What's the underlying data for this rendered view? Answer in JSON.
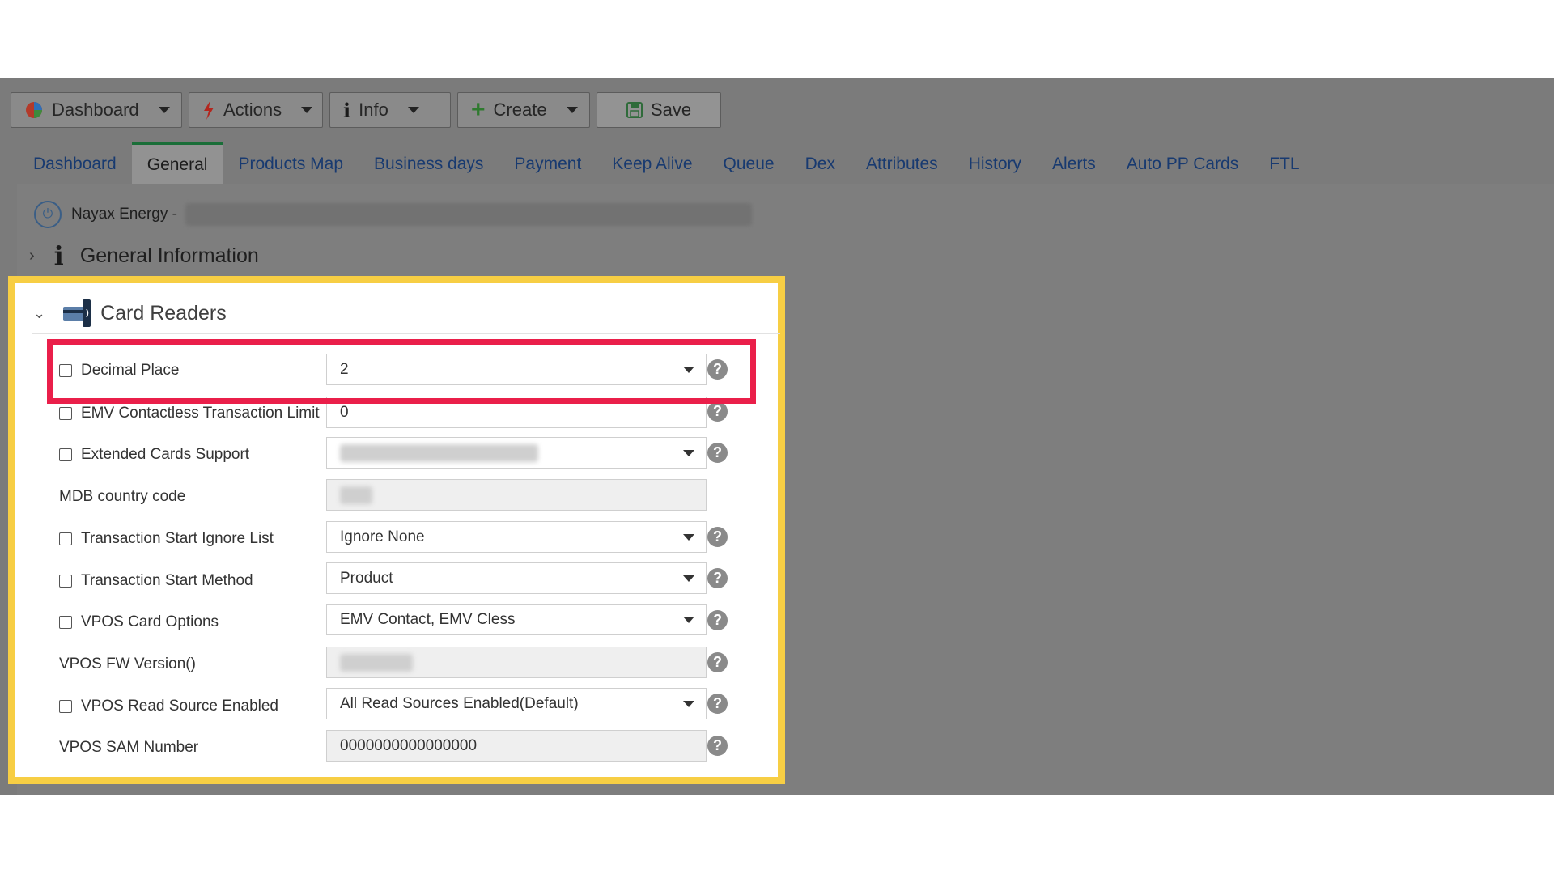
{
  "toolbar": {
    "dashboard": "Dashboard",
    "actions": "Actions",
    "info": "Info",
    "create": "Create",
    "save": "Save"
  },
  "tabs": [
    "Dashboard",
    "General",
    "Products Map",
    "Business days",
    "Payment",
    "Keep Alive",
    "Queue",
    "Dex",
    "Attributes",
    "History",
    "Alerts",
    "Auto PP Cards",
    "FTL"
  ],
  "active_tab": "General",
  "breadcrumb": {
    "prefix": "Nayax Energy -"
  },
  "sections": {
    "general_information": "General Information",
    "card_readers": "Card Readers"
  },
  "fields": {
    "decimal_place": {
      "label": "Decimal Place",
      "value": "2"
    },
    "emv_limit": {
      "label": "EMV Contactless Transaction Limit",
      "value": "0"
    },
    "extended_cards": {
      "label": "Extended Cards Support",
      "value": ""
    },
    "mdb_country": {
      "label": "MDB country code",
      "value": ""
    },
    "ts_ignore": {
      "label": "Transaction Start Ignore List",
      "value": "Ignore None"
    },
    "ts_method": {
      "label": "Transaction Start Method",
      "value": "Product"
    },
    "vpos_card": {
      "label": "VPOS Card Options",
      "value": "EMV Contact, EMV Cless"
    },
    "vpos_fw": {
      "label": "VPOS FW Version()",
      "value": ""
    },
    "vpos_read": {
      "label": "VPOS Read Source Enabled",
      "value": "All Read Sources Enabled(Default)"
    },
    "vpos_sam": {
      "label": "VPOS SAM Number",
      "value": "0000000000000000"
    }
  },
  "colors": {
    "highlight_yellow": "#f7ce44",
    "highlight_red": "#ea1f4a",
    "tab_link": "#183a70",
    "active_tab_border": "#1a6e38"
  }
}
